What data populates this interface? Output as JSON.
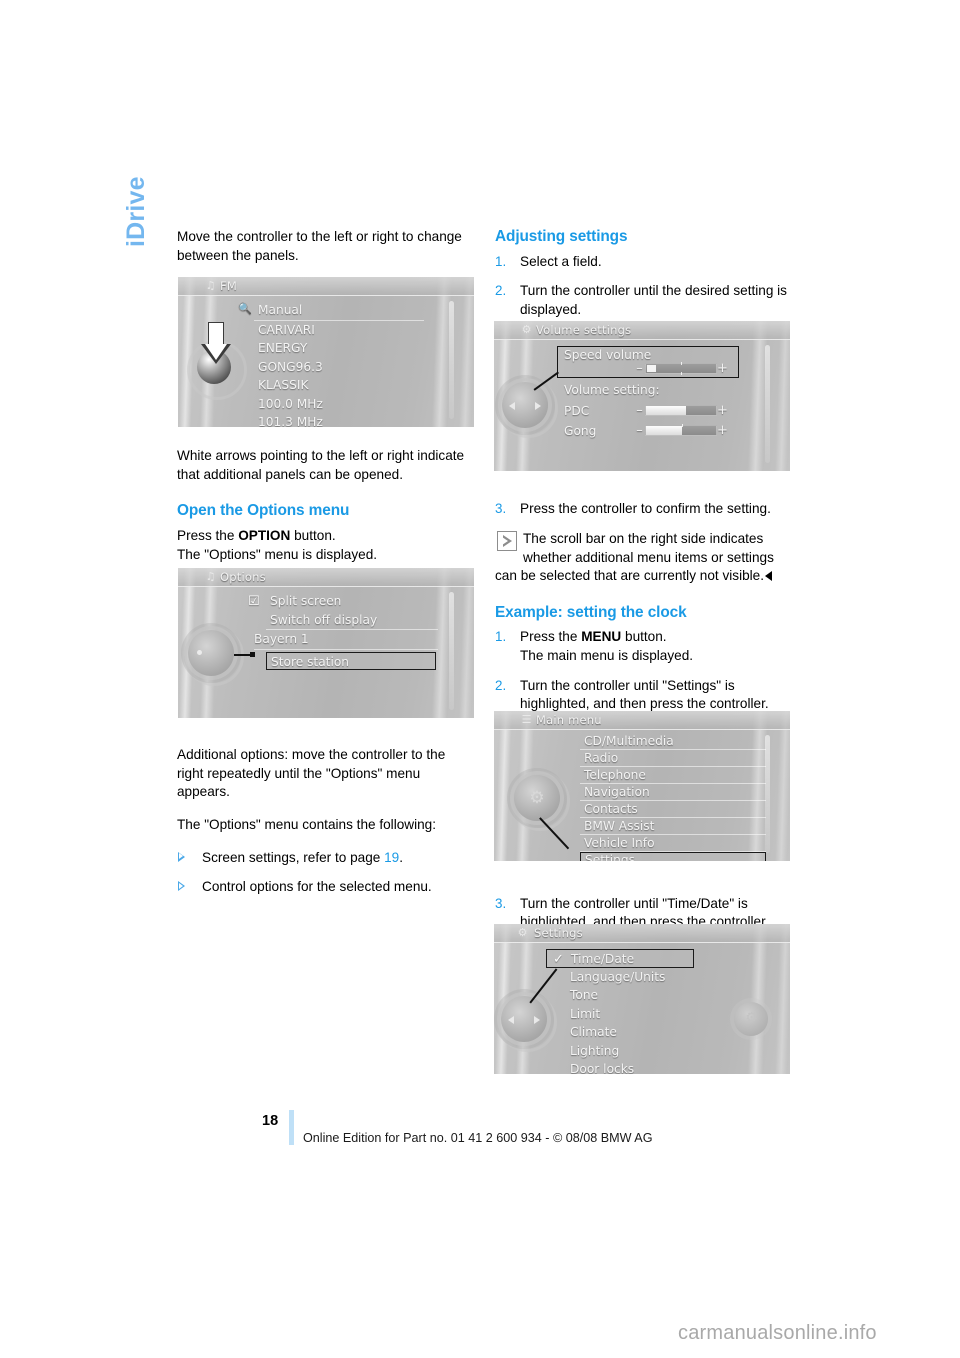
{
  "chapter_tab": "iDrive",
  "left_column": {
    "intro_paragraph": "Move the controller to the left or right to change between the panels.",
    "fm_figure": {
      "title": "FM",
      "title_icon": "radio-icon",
      "items": [
        "Manual",
        "CARIVARI",
        "ENERGY",
        "GONG96.3",
        "KLASSIK",
        "100.0 MHz",
        "101.3 MHz"
      ],
      "search_icon": "magnifier-icon",
      "arrow_icon": "down-arrow-icon"
    },
    "after_fm_paragraph": "White arrows pointing to the left or right indicate that additional panels can be opened.",
    "options_heading": "Open the Options menu",
    "options_line1_pre": "Press the ",
    "options_line1_bold": "OPTION",
    "options_line1_post": " button.",
    "options_line2": "The \"Options\" menu is displayed.",
    "options_figure": {
      "title": "Options",
      "title_icon": "options-icon",
      "items": [
        "Split screen",
        "Switch off display",
        "Bayern 1",
        "Store station"
      ],
      "checkbox_icon": "checkbox-checked-icon",
      "highlighted": "Store station"
    },
    "additional_options_paragraph": "Additional options: move the controller to the right repeatedly until the \"Options\" menu appears.",
    "contains_paragraph": "The \"Options\" menu contains the following:",
    "bullets": [
      {
        "text_pre": "Screen settings, refer to page ",
        "page_ref": "19",
        "text_post": "."
      },
      {
        "text_pre": "Control options for the selected menu.",
        "page_ref": "",
        "text_post": ""
      }
    ]
  },
  "right_column": {
    "adjusting_heading": "Adjusting settings",
    "adjusting_steps": [
      {
        "num": "1.",
        "text": "Select a field."
      },
      {
        "num": "2.",
        "text": "Turn the controller until the desired setting is displayed."
      }
    ],
    "volume_figure": {
      "title": "Volume settings",
      "title_icon": "settings-icon",
      "field_speed_volume": "Speed volume",
      "label_volume_setting": "Volume setting:",
      "rows": [
        "PDC",
        "Gong"
      ],
      "minus": "–",
      "plus": "+"
    },
    "step3": {
      "num": "3.",
      "text": "Press the controller to confirm the setting."
    },
    "note_icon": "boxed-triangle-icon",
    "note_text": "The scroll bar on the right side indicates whether additional menu items or settings can be selected that are currently not visible.",
    "example_heading": "Example: setting the clock",
    "example_steps": [
      {
        "num": "1.",
        "pre": "Press the ",
        "bold": "MENU",
        "post": " button.",
        "second_line": "The main menu is displayed."
      },
      {
        "num": "2.",
        "pre": "",
        "bold": "",
        "post": "Turn the controller until \"Settings\" is highlighted, and then press the controller.",
        "second_line": ""
      }
    ],
    "main_menu_figure": {
      "title": "Main menu",
      "title_icon": "menu-icon",
      "items": [
        "CD/Multimedia",
        "Radio",
        "Telephone",
        "Navigation",
        "Contacts",
        "BMW Assist",
        "Vehicle Info",
        "Settings"
      ],
      "highlighted": "Settings"
    },
    "step3b": {
      "num": "3.",
      "text": "Turn the controller until \"Time/Date\" is highlighted, and then press the controller."
    },
    "settings_figure": {
      "title": "Settings",
      "title_icon": "gear-icon",
      "items": [
        "Time/Date",
        "Language/Units",
        "Tone",
        "Limit",
        "Climate",
        "Lighting",
        "Door locks"
      ],
      "highlighted": "Time/Date",
      "check_icon": "check-icon"
    }
  },
  "footer": {
    "page_number": "18",
    "text": "Online Edition for Part no. 01 41 2 600 934 - © 08/08 BMW AG"
  },
  "watermark": "carmanualsonline.info",
  "colors": {
    "accent_blue": "#1a9ae5",
    "tab_blue": "#74b7ef",
    "rule_blue": "#bfe0f7"
  }
}
